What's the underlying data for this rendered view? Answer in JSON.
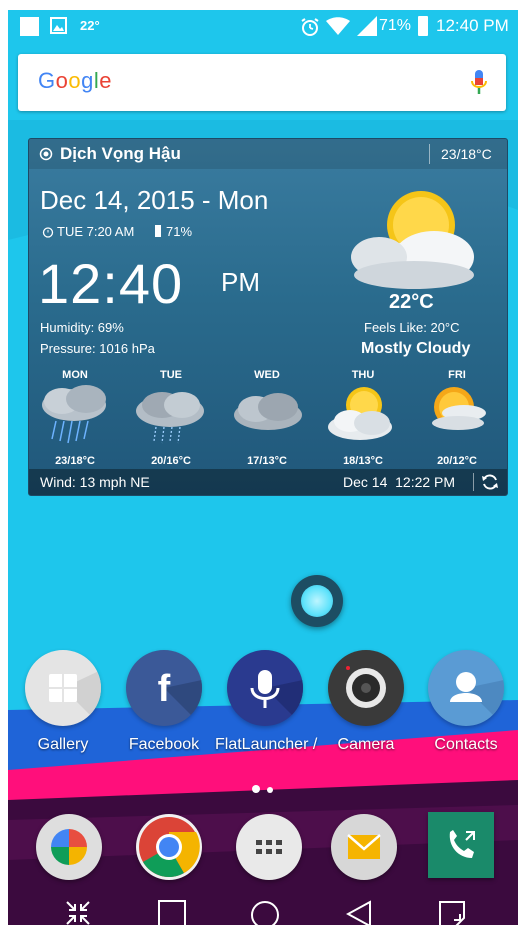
{
  "status_bar": {
    "temperature": "22°",
    "battery": "71%",
    "time": "12:40 PM"
  },
  "search": {
    "logo_text": "Google"
  },
  "weather_widget": {
    "location": "Dịch Vọng Hậu",
    "hi_lo": "23/18°C",
    "date": "Dec 14, 2015 - Mon",
    "alarm": "TUE 7:20 AM",
    "battery": "71%",
    "time": "12:40",
    "ampm": "PM",
    "current_temp": "22°C",
    "humidity": "Humidity: 69%",
    "pressure": "Pressure: 1016 hPa",
    "feels_like": "Feels Like: 20°C",
    "condition": "Mostly Cloudy",
    "forecast": [
      {
        "day": "MON",
        "temps": "23/18°C",
        "icon": "rain-cloud-icon"
      },
      {
        "day": "TUE",
        "temps": "20/16°C",
        "icon": "drizzle-cloud-icon"
      },
      {
        "day": "WED",
        "temps": "17/13°C",
        "icon": "cloud-icon"
      },
      {
        "day": "THU",
        "temps": "18/13°C",
        "icon": "sun-cloud-icon"
      },
      {
        "day": "FRI",
        "temps": "20/12°C",
        "icon": "sun-cloud-icon"
      }
    ],
    "wind": "Wind: 13 mph NE",
    "updated": "Dec 14  12:22 PM"
  },
  "apps": [
    {
      "label": "Gallery",
      "icon": "gallery-icon"
    },
    {
      "label": "Facebook",
      "icon": "facebook-icon"
    },
    {
      "label": "FlatLauncher /",
      "icon": "microphone-icon"
    },
    {
      "label": "Camera",
      "icon": "camera-icon"
    },
    {
      "label": "Contacts",
      "icon": "contacts-icon"
    }
  ],
  "dock": [
    {
      "icon": "photos-icon"
    },
    {
      "icon": "chrome-icon"
    },
    {
      "icon": "app-drawer-icon"
    },
    {
      "icon": "email-icon"
    },
    {
      "icon": "phone-icon"
    }
  ],
  "nav_bar": [
    "collapse-icon",
    "recents-icon",
    "home-icon",
    "back-icon",
    "notification-icon"
  ],
  "colors": {
    "sky": "#1ec6ec",
    "pink_band": "#ff0f7b",
    "blue_band": "#1f64d8",
    "dark_bottom": "#3b0a3e"
  }
}
